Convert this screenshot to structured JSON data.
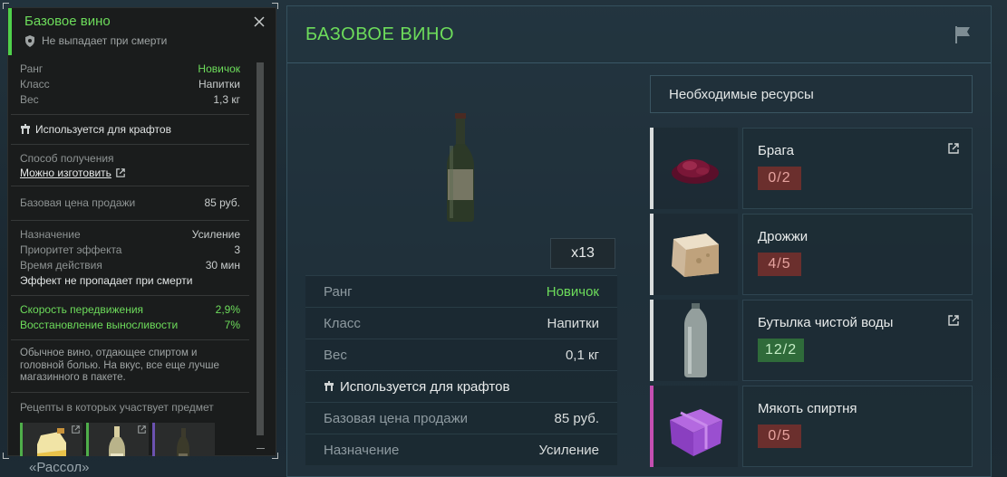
{
  "background": {
    "caption": "«Рассол»"
  },
  "tooltip": {
    "title": "Базовое вино",
    "subtitle": "Не выпадает при смерти",
    "stats": [
      {
        "label": "Ранг",
        "value": "Новичок",
        "accent": true
      },
      {
        "label": "Класс",
        "value": "Напитки",
        "accent": false
      },
      {
        "label": "Вес",
        "value": "1,3 кг",
        "accent": false
      }
    ],
    "craft_label": "Используется для крафтов",
    "obtain_label": "Способ получения",
    "obtain_link": "Можно изготовить",
    "sell_label": "Базовая цена продажи",
    "sell_value": "85 руб.",
    "effect": [
      {
        "label": "Назначение",
        "value": "Усиление"
      },
      {
        "label": "Приоритет эффекта",
        "value": "3"
      },
      {
        "label": "Время действия",
        "value": "30 мин"
      }
    ],
    "effect_note": "Эффект не пропадает при смерти",
    "bonuses": [
      {
        "label": "Скорость передвижения",
        "value": "2,9%"
      },
      {
        "label": "Восстановление выносливости",
        "value": "7%"
      }
    ],
    "description": "Обычное вино, отдающее спиртом и головной болью. На вкус, все еще лучше магазинного в пакете.",
    "recipes_label": "Рецепты в которых участвует предмет",
    "recipe_colors": [
      "#4fae4a",
      "#4fae4a",
      "#6b52b0"
    ]
  },
  "panel": {
    "title": "БАЗОВОЕ ВИНО",
    "count": "x13",
    "stats": [
      {
        "label": "Ранг",
        "value": "Новичок",
        "accent": true
      },
      {
        "label": "Класс",
        "value": "Напитки",
        "accent": false
      },
      {
        "label": "Вес",
        "value": "0,1 кг",
        "accent": false
      }
    ],
    "craft_label": "Используется для крафтов",
    "sell_label": "Базовая цена продажи",
    "sell_value": "85 руб.",
    "purpose_label": "Назначение",
    "purpose_value": "Усиление",
    "resources_header": "Необходимые ресурсы",
    "resources": [
      {
        "name": "Брага",
        "qty": "0/2",
        "status": "red",
        "bar_color": "#d9dcdc",
        "icon": "braga-icon",
        "has_link": true
      },
      {
        "name": "Дрожжи",
        "qty": "4/5",
        "status": "red",
        "bar_color": "#d9dcdc",
        "icon": "yeast-icon",
        "has_link": false
      },
      {
        "name": "Бутылка чистой воды",
        "qty": "12/2",
        "status": "green",
        "bar_color": "#d9dcdc",
        "icon": "water-bottle-icon",
        "has_link": true
      },
      {
        "name": "Мякоть спиртня",
        "qty": "0/5",
        "status": "red",
        "bar_color": "#c44fb1",
        "icon": "purple-cube-icon",
        "has_link": false
      }
    ]
  }
}
